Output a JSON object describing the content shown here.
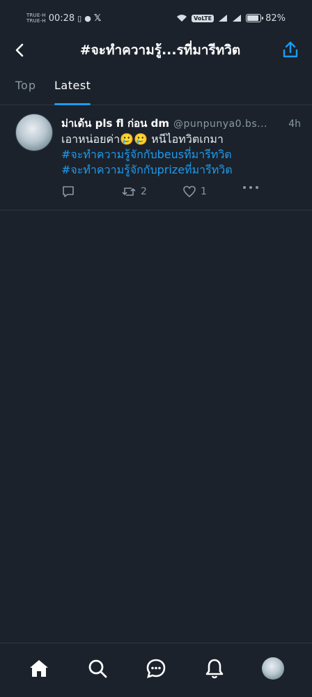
{
  "status_bar": {
    "carrier_1": "TRUE-H",
    "carrier_2": "TRUE-H",
    "time": "00:28",
    "battery_percent": "82%",
    "volte_label": "VoLTE"
  },
  "header": {
    "title": "#จะทำความรู้...รที่มารีทวิต"
  },
  "tabs": [
    {
      "label": "Top",
      "active": false
    },
    {
      "label": "Latest",
      "active": true
    }
  ],
  "post": {
    "display_name": "ม่าเด้น pls fl ก่อน dm",
    "handle": "@punpunya0.bs...",
    "time": "4h",
    "text": "เอาหน่อยค่า🥲🥲  หนีไอทวิตเกมา",
    "hashtags": [
      "#จะทำความรู้จักกับbeusที่มารีทวิต",
      "#จะทำความรู้จักกับprizeที่มารีทวิต"
    ],
    "retweet_count": "2",
    "like_count": "1"
  },
  "colors": {
    "background": "#1b222b",
    "accent": "#1d9bf0",
    "muted": "#8b98a5"
  },
  "bottom_nav": [
    "home-icon",
    "search-icon",
    "messages-icon",
    "notifications-icon",
    "profile-avatar"
  ]
}
